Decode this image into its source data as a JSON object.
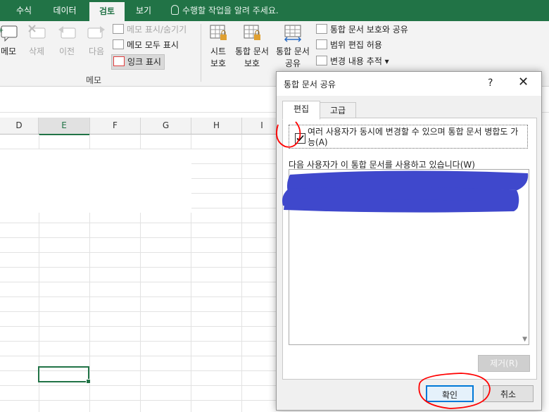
{
  "tabs": [
    {
      "label": "수식"
    },
    {
      "label": "데이터"
    },
    {
      "label": "검토"
    },
    {
      "label": "보기"
    }
  ],
  "tellme": "수행할 작업을 알려 주세요.",
  "ribbon": {
    "memo_group": {
      "new_label": "메모",
      "delete_label": "삭제",
      "prev_label": "이전",
      "next_label": "다음",
      "show_hide": "메모 표시/숨기기",
      "show_all": "메모 모두 표시",
      "show_ink": "잉크 표시",
      "group_label": "메모"
    },
    "changes_group": {
      "protect_sheet": [
        "시트",
        "보호"
      ],
      "protect_workbook": [
        "통합 문서",
        "보호"
      ],
      "share_workbook": [
        "통합 문서",
        "공유"
      ],
      "protect_and_share": "통합 문서 보호와 공유",
      "allow_edit_ranges": "범위 편집 허용",
      "track_changes": "변경 내용 추적 ▾"
    }
  },
  "columns": [
    "D",
    "E",
    "F",
    "G",
    "H",
    "I"
  ],
  "dialog": {
    "title": "통합 문서 공유",
    "help": "?",
    "close": "✕",
    "tabs": [
      "편집",
      "고급"
    ],
    "checkbox_label": "여러 사용자가 동시에 변경할 수 있으며 통합 문서 병합도 가능(A)",
    "checkbox_checked": true,
    "list_label": "다음 사용자가 이 통합 문서를 사용하고 있습니다(W)",
    "remove_button": "제거(R)",
    "ok_button": "확인",
    "cancel_button": "취소"
  },
  "colors": {
    "excel_green": "#217346",
    "redaction_blue": "#3f48cc",
    "annotation_red": "#ff0000"
  }
}
